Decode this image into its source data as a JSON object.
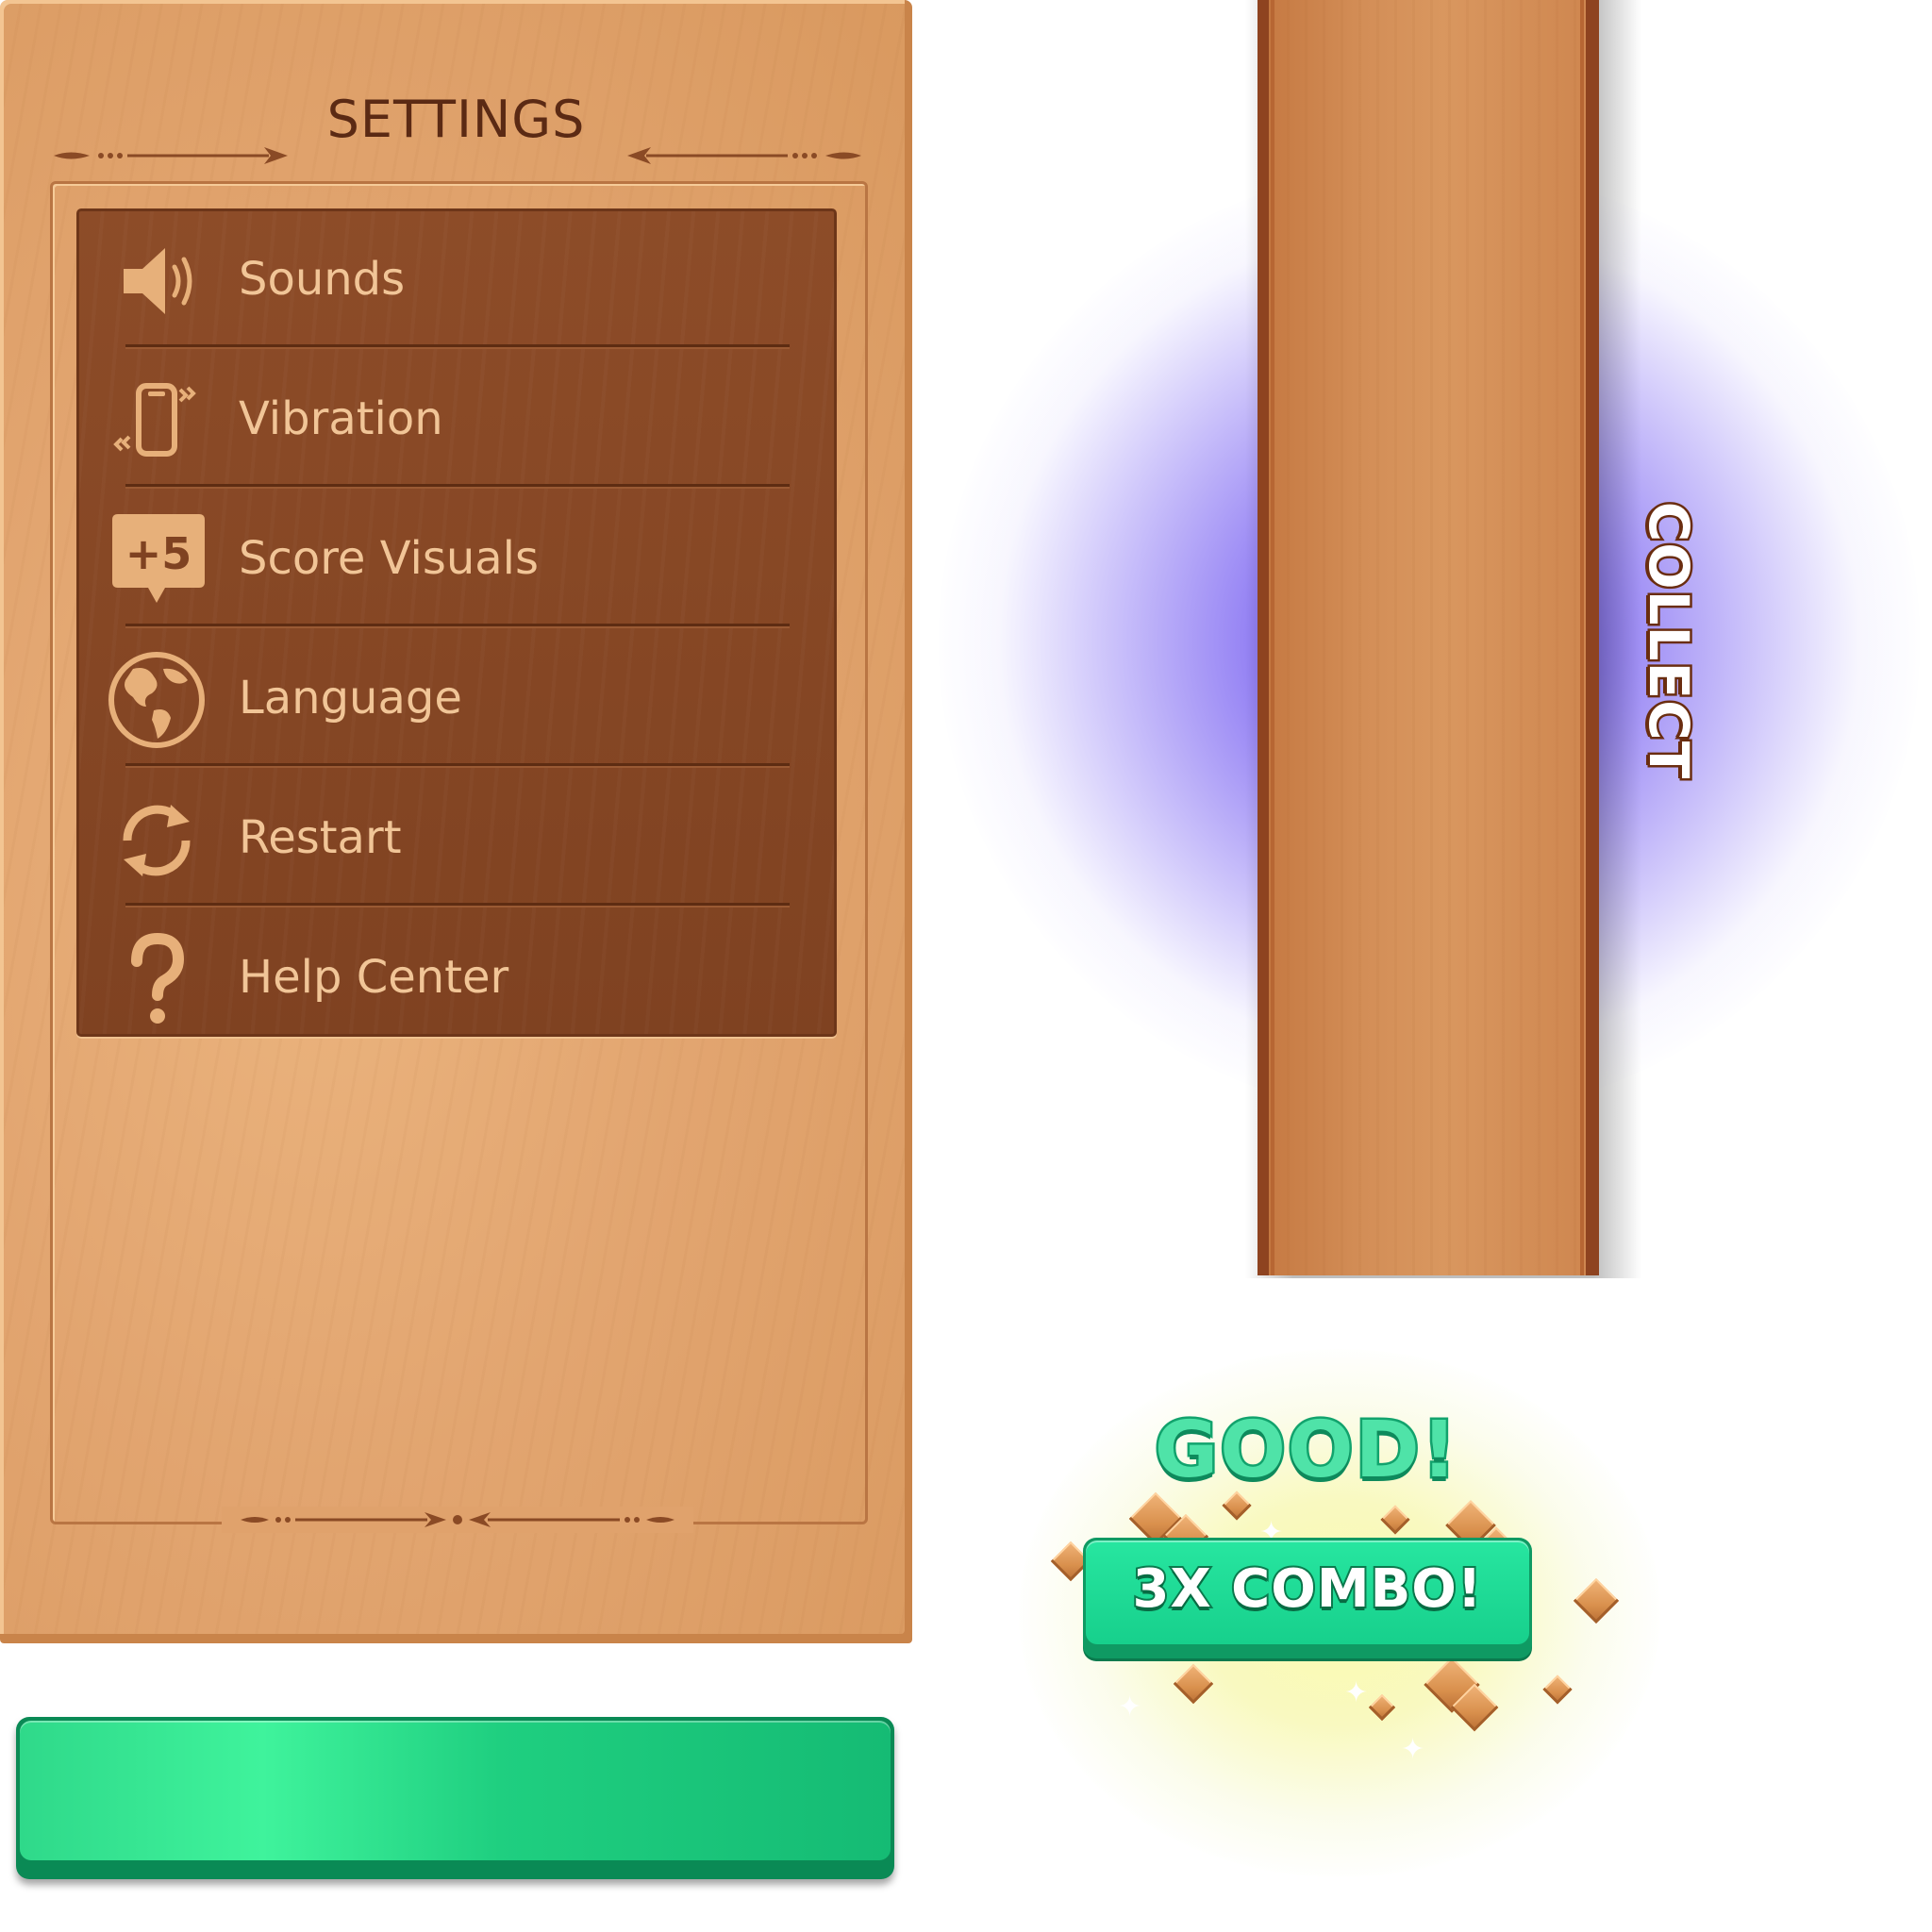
{
  "settings": {
    "title": "SETTINGS",
    "items": [
      {
        "label": "Sounds",
        "icon": "speaker-icon"
      },
      {
        "label": "Vibration",
        "icon": "phone-vibrate-icon"
      },
      {
        "label": "Score Visuals",
        "icon": "plus-five-bubble-icon",
        "icon_text": "+5"
      },
      {
        "label": "Language",
        "icon": "globe-icon"
      },
      {
        "label": "Restart",
        "icon": "refresh-icon"
      },
      {
        "label": "Help Center",
        "icon": "question-mark-icon"
      }
    ]
  },
  "plank": {
    "collect_label": "COLLECT",
    "glow_color": "#6a4df0"
  },
  "combo": {
    "good_text": "GOOD!",
    "combo_text": "3X COMBO!"
  },
  "colors": {
    "wood_light": "#e2a570",
    "wood_dark": "#7f4221",
    "menu_text": "#f1c597",
    "title_text": "#5b2a14",
    "green_button": "#1fcf80",
    "good_green": "#4fe3a8"
  }
}
